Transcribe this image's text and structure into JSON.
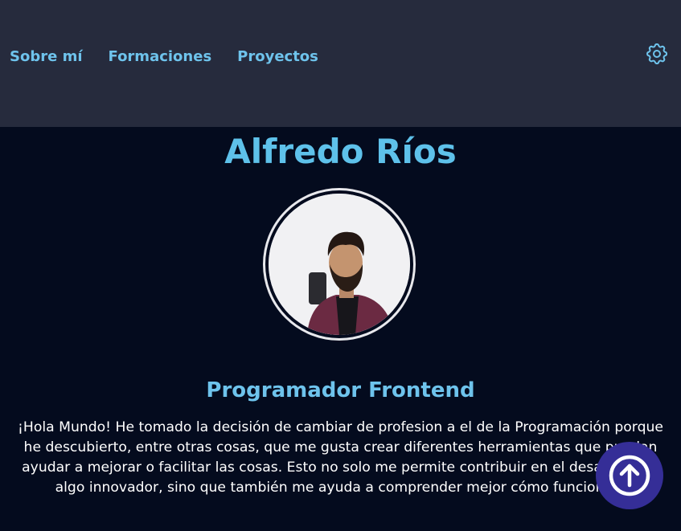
{
  "nav": {
    "items": [
      {
        "label": "Sobre mí"
      },
      {
        "label": "Formaciones"
      },
      {
        "label": "Proyectos"
      }
    ],
    "settings_icon": "gear-icon"
  },
  "profile": {
    "name": "Alfredo Ríos",
    "role": "Programador Frontend",
    "bio": "¡Hola Mundo! He tomado la decisión de cambiar de profesion a el de la Programación porque he descubierto, entre otras cosas, que me gusta crear diferentes herramientas que puedan ayudar a mejorar o facilitar las cosas. Esto no solo me permite contribuir en el desarrollo de algo innovador, sino que también me ayuda a comprender mejor cómo funcionan."
  },
  "scroll_top_icon": "arrow-up-circle-icon",
  "colors": {
    "header_bg": "#262b3d",
    "page_bg": "#040b1e",
    "accent": "#5ec1ea",
    "button_bg": "#352e97"
  }
}
